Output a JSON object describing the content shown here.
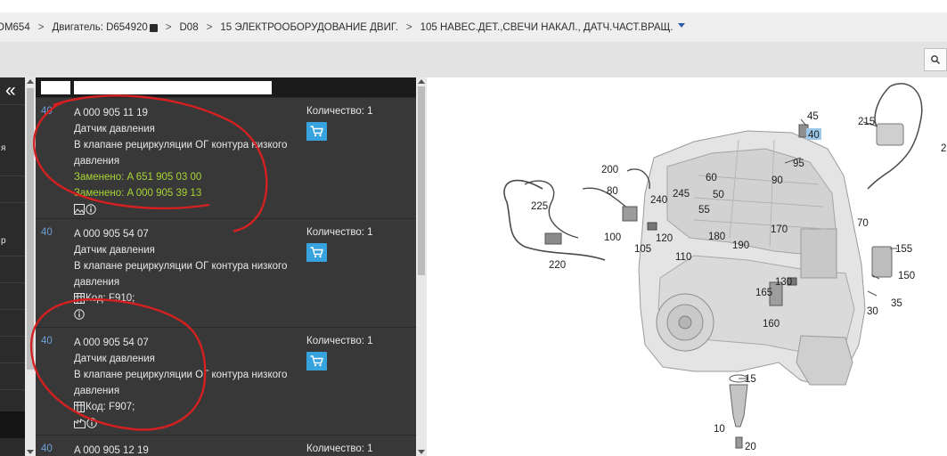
{
  "breadcrumb": {
    "model": "OM654",
    "engine": "Двигатель: D654920",
    "group": "D08",
    "section": "15 ЭЛЕКТРООБОРУДОВАНИЕ ДВИГ.",
    "subsection": "105 НАВЕС.ДЕТ.,СВЕЧИ НАКАЛ., ДАТЧ.ЧАСТ.ВРАЩ."
  },
  "toolbar": {
    "search_icon": "search-icon"
  },
  "left_nav": {
    "collapse_label": "«",
    "fragments": [
      "я",
      "р"
    ]
  },
  "parts": [
    {
      "position": "40",
      "number": "A 000 905 11 19",
      "name": "Датчик давления",
      "description": "В клапане рециркуляции ОГ контура низкого давления",
      "replaced": [
        "Заменено: A 651 905 03 00",
        "Заменено: A 000 905 39 13"
      ],
      "code": "",
      "quantity_label": "Количество: 1"
    },
    {
      "position": "40",
      "number": "A 000 905 54 07",
      "name": "Датчик давления",
      "description": "В клапане рециркуляции ОГ контура низкого давления",
      "replaced": [],
      "code": "Код: F910;",
      "quantity_label": "Количество: 1"
    },
    {
      "position": "40",
      "number": "A 000 905 54 07",
      "name": "Датчик давления",
      "description": "В клапане рециркуляции ОГ контура низкого давления",
      "replaced": [],
      "code": "Код: F907;",
      "quantity_label": "Количество: 1"
    },
    {
      "position": "40",
      "number": "A 000 905 12 19",
      "name": "",
      "description": "",
      "replaced": [],
      "code": "",
      "quantity_label": "Количество: 1"
    }
  ],
  "diagram": {
    "callouts": [
      "45",
      "40",
      "215",
      "2",
      "95",
      "90",
      "200",
      "80",
      "60",
      "50",
      "55",
      "240",
      "245",
      "225",
      "170",
      "70",
      "100",
      "105",
      "120",
      "180",
      "190",
      "110",
      "220",
      "155",
      "150",
      "130",
      "165",
      "160",
      "35",
      "30",
      "15",
      "10",
      "20"
    ],
    "highlighted": "40"
  },
  "colors": {
    "panel_bg": "#383838",
    "header_bg": "#1b1b1b",
    "accent_blue": "#36a3de",
    "replaced_green": "#a8d437",
    "position_blue": "#6d9ed6",
    "annotation_red": "#d42020"
  }
}
